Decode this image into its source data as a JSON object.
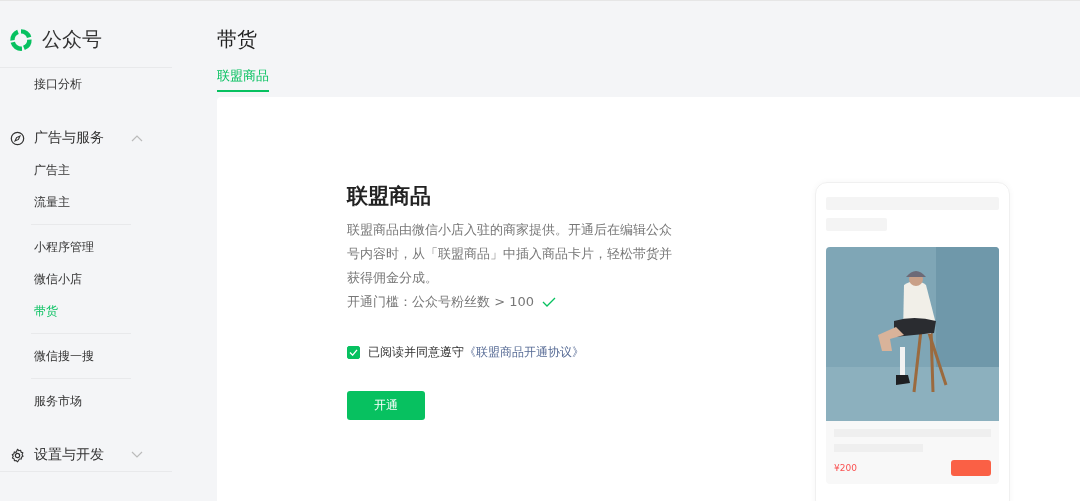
{
  "sidebar": {
    "logo_text": "公众号",
    "top_items": [
      {
        "label": "接口分析",
        "selected": false
      }
    ],
    "sections": [
      {
        "title": "广告与服务",
        "expanded": true,
        "groups": [
          [
            {
              "label": "广告主",
              "selected": false
            },
            {
              "label": "流量主",
              "selected": false
            }
          ],
          [
            {
              "label": "小程序管理",
              "selected": false
            },
            {
              "label": "微信小店",
              "selected": false
            },
            {
              "label": "带货",
              "selected": true
            }
          ],
          [
            {
              "label": "微信搜一搜",
              "selected": false
            }
          ],
          [
            {
              "label": "服务市场",
              "selected": false
            }
          ]
        ]
      },
      {
        "title": "设置与开发",
        "expanded": false
      }
    ]
  },
  "page": {
    "title": "带货",
    "tabs": [
      {
        "label": "联盟商品",
        "selected": true
      }
    ]
  },
  "content": {
    "heading": "联盟商品",
    "description": "联盟商品由微信小店入驻的商家提供。开通后在编辑公众号内容时，从「联盟商品」中插入商品卡片，轻松带货并获得佣金分成。",
    "threshold": {
      "text": "开通门槛：公众号粉丝数 > 100",
      "met": true
    },
    "agreement": {
      "checked": true,
      "text": "已阅读并同意遵守",
      "link": "《联盟商品开通协议》"
    },
    "button": "开通"
  },
  "preview": {
    "price": "¥200"
  }
}
